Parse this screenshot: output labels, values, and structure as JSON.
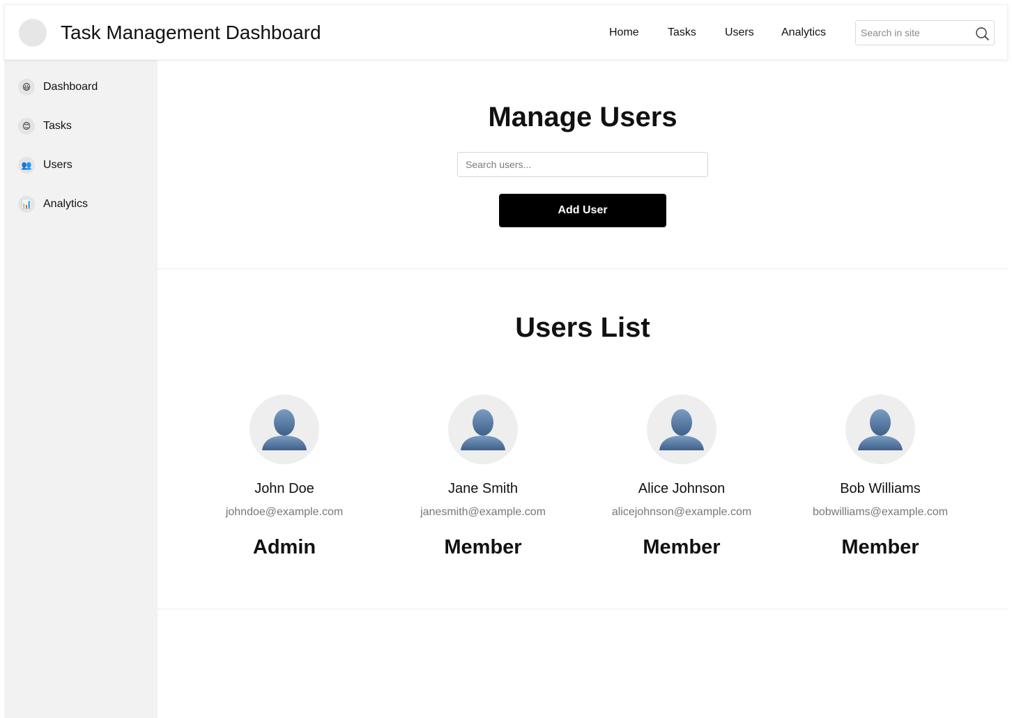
{
  "header": {
    "title": "Task Management Dashboard",
    "nav": [
      {
        "label": "Home"
      },
      {
        "label": "Tasks"
      },
      {
        "label": "Users"
      },
      {
        "label": "Analytics"
      }
    ],
    "search": {
      "placeholder": "Search in site",
      "value": "",
      "icon": "search-icon"
    }
  },
  "sidebar": {
    "items": [
      {
        "label": "Dashboard",
        "icon": "smiley-icon",
        "glyph": "😃"
      },
      {
        "label": "Tasks",
        "icon": "smile-icon",
        "glyph": "😊"
      },
      {
        "label": "Users",
        "icon": "users-icon",
        "glyph": "👥"
      },
      {
        "label": "Analytics",
        "icon": "bar-chart-icon",
        "glyph": "📊"
      }
    ]
  },
  "manage": {
    "title": "Manage Users",
    "search": {
      "placeholder": "Search users...",
      "value": ""
    },
    "add_button": "Add User"
  },
  "users_list": {
    "title": "Users List",
    "users": [
      {
        "name": "John Doe",
        "email": "johndoe@example.com",
        "role": "Admin"
      },
      {
        "name": "Jane Smith",
        "email": "janesmith@example.com",
        "role": "Member"
      },
      {
        "name": "Alice Johnson",
        "email": "alicejohnson@example.com",
        "role": "Member"
      },
      {
        "name": "Bob Williams",
        "email": "bobwilliams@example.com",
        "role": "Member"
      }
    ]
  },
  "colors": {
    "primary_button": "#000000",
    "sidebar_bg": "#f2f2f2",
    "avatar_figure": "#4f7299"
  }
}
